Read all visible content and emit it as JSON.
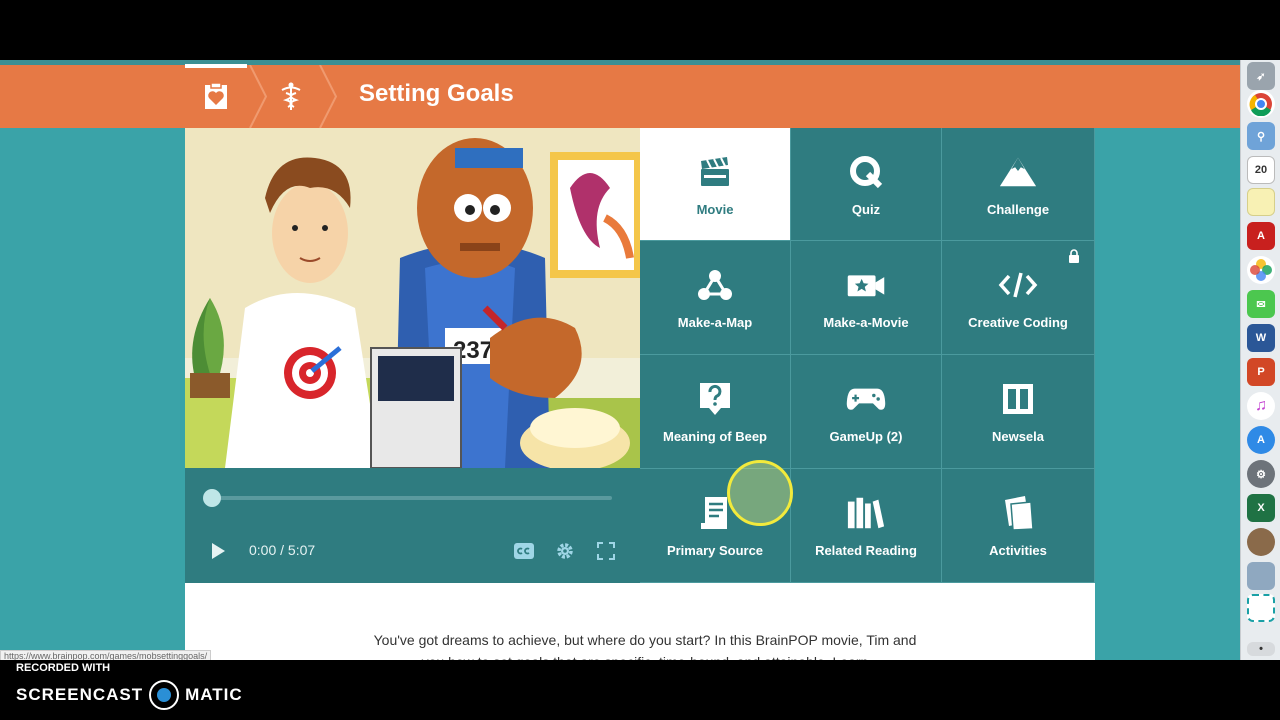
{
  "header": {
    "title": "Setting Goals",
    "icons": [
      "heart-card-icon",
      "health-caduceus-icon"
    ]
  },
  "video": {
    "time_current": "0:00",
    "time_separator": "/",
    "time_total": "5:07",
    "progress": 0,
    "bib_number": "237"
  },
  "features": [
    {
      "label": "Movie",
      "icon": "clapperboard-icon",
      "active": true
    },
    {
      "label": "Quiz",
      "icon": "quiz-q-icon",
      "active": false
    },
    {
      "label": "Challenge",
      "icon": "mountain-icon",
      "active": false
    },
    {
      "label": "Make-a-Map",
      "icon": "map-nodes-icon",
      "active": false
    },
    {
      "label": "Make-a-Movie",
      "icon": "video-camera-icon",
      "active": false
    },
    {
      "label": "Creative Coding",
      "icon": "code-icon",
      "active": false,
      "locked": true
    },
    {
      "label": "Meaning of Beep",
      "icon": "question-bubble-icon",
      "active": false
    },
    {
      "label": "GameUp (2)",
      "icon": "gamepad-icon",
      "active": false
    },
    {
      "label": "Newsela",
      "icon": "newsela-icon",
      "active": false
    },
    {
      "label": "Primary Source",
      "icon": "scroll-icon",
      "active": false
    },
    {
      "label": "Related Reading",
      "icon": "books-icon",
      "active": false
    },
    {
      "label": "Activities",
      "icon": "pages-icon",
      "active": false
    }
  ],
  "description": {
    "line1": "You've got dreams to achieve, but where do you start? In this BrainPOP movie, Tim and",
    "line2": "you how to set goals that are specific, time-bound, and attainable. Learn"
  },
  "status_url": "https://www.brainpop.com/games/mobsettinggoals/",
  "dock": {
    "calendar_day": "20",
    "icons": [
      "rocket-icon",
      "chrome-icon",
      "preview-icon",
      "calendar-icon",
      "notes-icon",
      "acrobat-icon",
      "photos-icon",
      "messages-icon",
      "word-icon",
      "powerpoint-icon",
      "itunes-icon",
      "app-store-icon",
      "system-prefs-icon",
      "excel-icon",
      "gimp-icon",
      "screenshot-icon",
      "screencast-icon",
      "more-icon"
    ]
  },
  "watermark": {
    "line1": "RECORDED WITH",
    "brand_left": "SCREENCAST",
    "brand_right": "MATIC"
  },
  "colors": {
    "orange": "#e67945",
    "teal": "#2f7c80",
    "bg_teal": "#3aa3a8"
  }
}
